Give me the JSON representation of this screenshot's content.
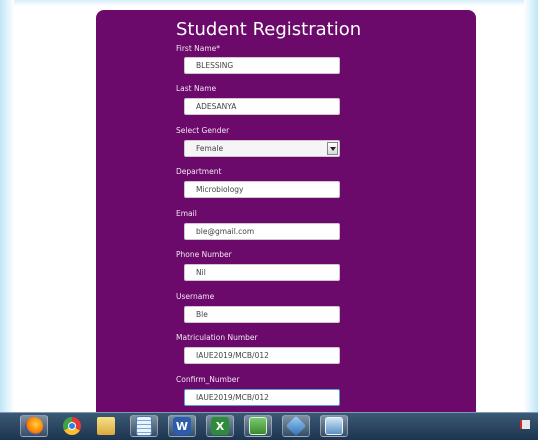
{
  "form": {
    "title": "Student Registration",
    "fields": [
      {
        "label": "First Name*",
        "value": "BLESSING"
      },
      {
        "label": "Last Name",
        "value": "ADESANYA"
      },
      {
        "label": "Select Gender",
        "value": "Female"
      },
      {
        "label": "Department",
        "value": "Microbiology"
      },
      {
        "label": "Email",
        "value": "ble@gmail.com"
      },
      {
        "label": "Phone Number",
        "value": "Nil"
      },
      {
        "label": "Username",
        "value": "Ble"
      },
      {
        "label": "Matriculation Number",
        "value": "IAUE2019/MCB/012"
      },
      {
        "label": "Confirm_Number",
        "value": "IAUE2019/MCB/012"
      }
    ]
  },
  "colors": {
    "card_background": "#6b0a6b",
    "field_background": "#ffffff",
    "taskbar": "#1c3450"
  },
  "taskbar": {
    "icons": [
      "firefox-icon",
      "chrome-icon",
      "file-explorer-icon",
      "notepad-icon",
      "word-icon",
      "excel-icon",
      "project-icon",
      "virtualbox-icon",
      "screenshot-icon"
    ],
    "tray_icons": [
      "flag-icon"
    ]
  }
}
